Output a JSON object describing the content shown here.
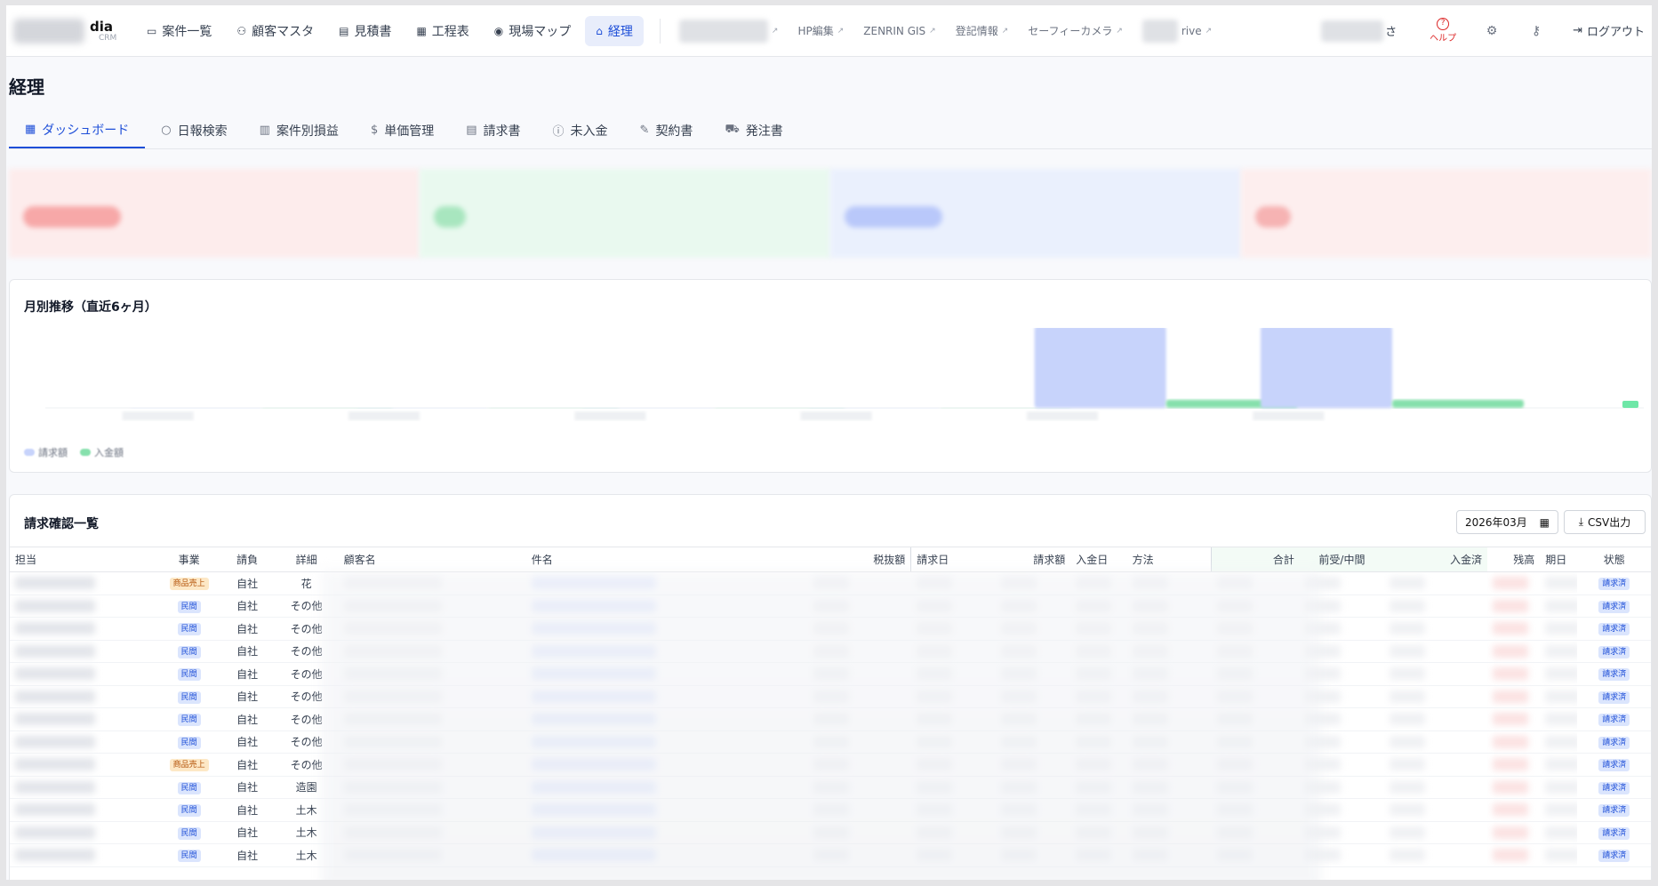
{
  "app": {
    "logo_text": "dia",
    "logo_sub": "CRM"
  },
  "nav": {
    "items": [
      {
        "label": "案件一覧",
        "icon": "briefcase-icon",
        "glyph": "▭"
      },
      {
        "label": "顧客マスタ",
        "icon": "users-icon",
        "glyph": "⚇"
      },
      {
        "label": "見積書",
        "icon": "document-icon",
        "glyph": "▤"
      },
      {
        "label": "工程表",
        "icon": "calendar-icon",
        "glyph": "▦"
      },
      {
        "label": "現場マップ",
        "icon": "map-pin-icon",
        "glyph": "◉"
      },
      {
        "label": "経理",
        "icon": "bank-icon",
        "glyph": "⌂"
      }
    ],
    "external_links": [
      {
        "label": "HP編集"
      },
      {
        "label": "ZENRIN GIS"
      },
      {
        "label": "登記情報"
      },
      {
        "label": "セーフィーカメラ"
      }
    ],
    "drive_suffix": "rive",
    "user_suffix": "さ",
    "help_label": "ヘルプ",
    "logout_label": "ログアウト"
  },
  "page": {
    "title": "経理"
  },
  "tabs": [
    {
      "label": "ダッシュボード",
      "icon": "dashboard-icon",
      "glyph": "▦"
    },
    {
      "label": "日報検索",
      "icon": "search-icon",
      "glyph": "○"
    },
    {
      "label": "案件別損益",
      "icon": "bar-chart-icon",
      "glyph": "▥"
    },
    {
      "label": "単価管理",
      "icon": "dollar-icon",
      "glyph": "$"
    },
    {
      "label": "請求書",
      "icon": "invoice-icon",
      "glyph": "▤"
    },
    {
      "label": "未入金",
      "icon": "alert-circle-icon",
      "glyph": "ⓘ"
    },
    {
      "label": "契約書",
      "icon": "edit-document-icon",
      "glyph": "✎"
    },
    {
      "label": "発注書",
      "icon": "cart-icon",
      "glyph": "⛟"
    }
  ],
  "monthly_chart": {
    "title": "月別推移（直近6ヶ月）",
    "legend": [
      {
        "label": "請求額",
        "color": "#c7d3fb"
      },
      {
        "label": "入金額",
        "color": "#86e0ac"
      }
    ]
  },
  "chart_data": {
    "type": "bar",
    "title": "月別推移（直近6ヶ月）",
    "categories": [
      "",
      "",
      "",
      "",
      "",
      ""
    ],
    "series": [
      {
        "name": "請求額",
        "color": "#c7d3fb",
        "values": [
          0,
          0,
          0,
          0,
          80,
          80
        ]
      },
      {
        "name": "入金額",
        "color": "#86e0ac",
        "values": [
          0,
          0,
          0,
          0,
          8,
          8
        ]
      }
    ],
    "ylim": [
      0,
      80
    ],
    "grid": false,
    "legend_position": "bottom-left"
  },
  "invoices": {
    "title": "請求確認一覧",
    "month_value": "2026年03月",
    "csv_label": "CSV出力",
    "columns": [
      "担当",
      "事業",
      "請負",
      "詳細",
      "顧客名",
      "件名",
      "税抜額",
      "請求日",
      "請求額",
      "入金日",
      "方法",
      "合計",
      "前受/中間",
      "入金済",
      "残高",
      "期日",
      "状態"
    ],
    "rows": [
      {
        "biz": "商品売上",
        "biz_type": "goods",
        "contract": "自社",
        "detail": "花",
        "status": "請求済"
      },
      {
        "biz": "民間",
        "biz_type": "private",
        "contract": "自社",
        "detail": "その他",
        "status": "請求済"
      },
      {
        "biz": "民間",
        "biz_type": "private",
        "contract": "自社",
        "detail": "その他",
        "status": "請求済"
      },
      {
        "biz": "民間",
        "biz_type": "private",
        "contract": "自社",
        "detail": "その他",
        "status": "請求済"
      },
      {
        "biz": "民間",
        "biz_type": "private",
        "contract": "自社",
        "detail": "その他",
        "status": "請求済"
      },
      {
        "biz": "民間",
        "biz_type": "private",
        "contract": "自社",
        "detail": "その他",
        "status": "請求済"
      },
      {
        "biz": "民間",
        "biz_type": "private",
        "contract": "自社",
        "detail": "その他",
        "status": "請求済"
      },
      {
        "biz": "民間",
        "biz_type": "private",
        "contract": "自社",
        "detail": "その他",
        "status": "請求済"
      },
      {
        "biz": "商品売上",
        "biz_type": "goods",
        "contract": "自社",
        "detail": "その他",
        "status": "請求済"
      },
      {
        "biz": "民間",
        "biz_type": "private",
        "contract": "自社",
        "detail": "造園",
        "status": "請求済"
      },
      {
        "biz": "民間",
        "biz_type": "private",
        "contract": "自社",
        "detail": "土木",
        "status": "請求済"
      },
      {
        "biz": "民間",
        "biz_type": "private",
        "contract": "自社",
        "detail": "土木",
        "status": "請求済"
      },
      {
        "biz": "民間",
        "biz_type": "private",
        "contract": "自社",
        "detail": "土木",
        "status": "請求済"
      }
    ]
  }
}
